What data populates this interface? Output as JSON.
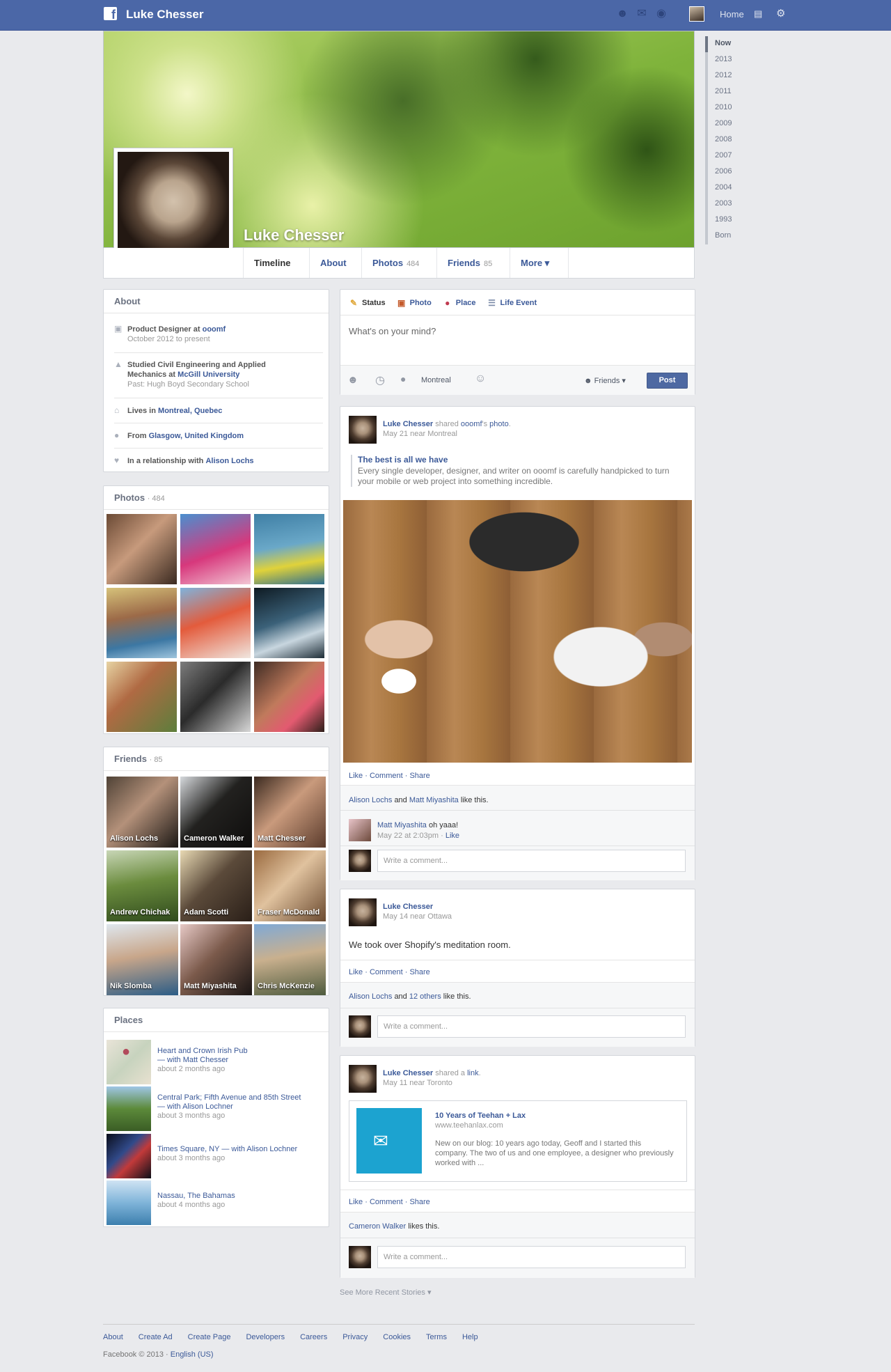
{
  "topbar": {
    "name": "Luke Chesser",
    "home": "Home",
    "separator": "|",
    "icons": [
      "friend-requests-icon",
      "messages-icon",
      "notifications-icon",
      "settings-gear-icon"
    ]
  },
  "profile": {
    "name": "Luke Chesser",
    "tabs": [
      {
        "label": "Timeline"
      },
      {
        "label": "About"
      },
      {
        "label": "Photos",
        "count": "484"
      },
      {
        "label": "Friends",
        "count": "85"
      },
      {
        "label": "More ▾"
      }
    ]
  },
  "years": [
    "Now",
    "2013",
    "2012",
    "2011",
    "2010",
    "2009",
    "2008",
    "2007",
    "2006",
    "2004",
    "2003",
    "1993",
    "Born"
  ],
  "about": {
    "title": "About",
    "job_role": "Product Designer at",
    "job_company": "ooomf",
    "job_dates": "October 2012 to present",
    "edu_text": "Studied Civil Engineering and Applied Mechanics at",
    "edu_school": "McGill University",
    "edu_past": "Past: Hugh Boyd Secondary School",
    "lives_label": "Lives in",
    "lives_place": "Montreal, Quebec",
    "from_label": "From",
    "from_place": "Glasgow, United Kingdom",
    "rel_label": "In a relationship with",
    "rel_name": "Alison Lochs"
  },
  "photos": {
    "title": "Photos",
    "count": "· 484"
  },
  "friends": {
    "title": "Friends",
    "count": "· 85",
    "names": [
      "Alison Lochs",
      "Cameron Walker",
      "Matt Chesser",
      "Andrew Chichak",
      "Adam Scotti",
      "Fraser McDonald",
      "Nik Slomba",
      "Matt Miyashita",
      "Chris McKenzie"
    ]
  },
  "places": {
    "title": "Places",
    "items": [
      {
        "name": "Heart and Crown Irish Pub",
        "with": "— with",
        "friend": "Matt Chesser",
        "time": "about 2 months ago"
      },
      {
        "name": "Central Park; Fifth Avenue and 85th Street",
        "with": "— with",
        "friend": "Alison Lochner",
        "time": "about 3 months ago"
      },
      {
        "name": "Times Square, NY",
        "with": "— with",
        "friend": "Alison Lochner",
        "time": "about 3 months ago"
      },
      {
        "name": "Nassau, The Bahamas",
        "with": "",
        "friend": "",
        "time": "about 4 months ago"
      }
    ]
  },
  "composer": {
    "tabs": [
      "Status",
      "Photo",
      "Place",
      "Life Event"
    ],
    "placeholder": "What's on your mind?",
    "location": "Montreal",
    "audience": "Friends",
    "post": "Post"
  },
  "post1": {
    "author": "Luke Chesser",
    "shared": "shared",
    "owner": "ooomf",
    "owner_suffix": "'s",
    "object": "photo",
    "meta": "May 21 near Montreal",
    "quote_title": "The best is all we have",
    "quote_text": "Every single developer, designer, and writer on ooomf is carefully handpicked to turn your mobile or web project into something incredible.",
    "like": "Like",
    "comment": "Comment",
    "share": "Share",
    "likers_a": "Alison Lochs",
    "likers_and": "and",
    "likers_b": "Matt Miyashita",
    "likers_suffix": "like this.",
    "c_author": "Matt Miyashita",
    "c_text": "oh yaaa!",
    "c_time": "May 22 at 2:03pm",
    "c_like": "Like",
    "write": "Write a comment..."
  },
  "post2": {
    "author": "Luke Chesser",
    "meta": "May 14 near Ottawa",
    "text": "We took over Shopify's meditation room.",
    "like": "Like",
    "comment": "Comment",
    "share": "Share",
    "likers_a": "Alison Lochs",
    "likers_and": "and",
    "likers_b": "12 others",
    "likers_suffix": "like this.",
    "write": "Write a comment..."
  },
  "post3": {
    "author": "Luke Chesser",
    "shared": "shared a",
    "object": "link",
    "meta": "May 11 near Toronto",
    "link_title": "10 Years of Teehan + Lax",
    "link_url": "www.teehanlax.com",
    "link_desc": "New on our blog: 10 years ago today, Geoff and I started this company. The two of us and one employee, a designer who previously worked with ...",
    "like": "Like",
    "comment": "Comment",
    "share": "Share",
    "liker": "Cameron Walker",
    "liker_suffix": "likes this.",
    "write": "Write a comment..."
  },
  "see_more": "See More Recent Stories ▾",
  "footer": {
    "links": [
      "About",
      "Create Ad",
      "Create Page",
      "Developers",
      "Careers",
      "Privacy",
      "Cookies",
      "Terms",
      "Help"
    ],
    "copy": "Facebook © 2013 ·",
    "lang": "English (US)"
  }
}
